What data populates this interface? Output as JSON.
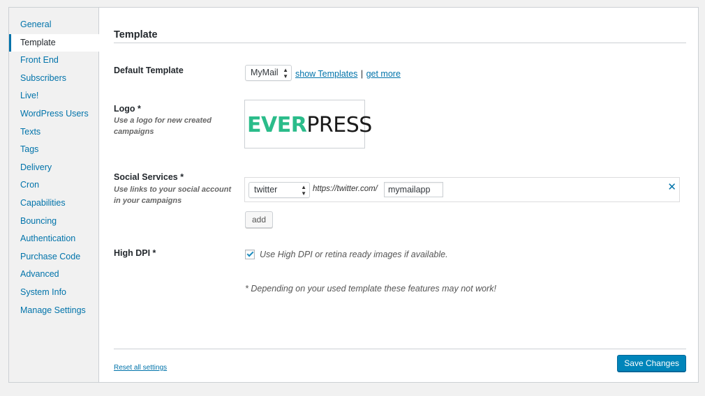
{
  "sidebar": {
    "items": [
      {
        "label": "General"
      },
      {
        "label": "Template"
      },
      {
        "label": "Front End"
      },
      {
        "label": "Subscribers"
      },
      {
        "label": "Live!"
      },
      {
        "label": "WordPress Users"
      },
      {
        "label": "Texts"
      },
      {
        "label": "Tags"
      },
      {
        "label": "Delivery"
      },
      {
        "label": "Cron"
      },
      {
        "label": "Capabilities"
      },
      {
        "label": "Bouncing"
      },
      {
        "label": "Authentication"
      },
      {
        "label": "Purchase Code"
      },
      {
        "label": "Advanced"
      },
      {
        "label": "System Info"
      },
      {
        "label": "Manage Settings"
      }
    ],
    "active": "Template"
  },
  "main": {
    "title": "Template",
    "default_template": {
      "label": "Default Template",
      "selected": "MyMail",
      "show_link": "show Templates",
      "separator": "|",
      "more_link": "get more"
    },
    "logo": {
      "label": "Logo *",
      "description": "Use a logo for new created campaigns",
      "brand_part1": "EVER",
      "brand_part2": "PRESS"
    },
    "social": {
      "label": "Social Services *",
      "description": "Use links to your social account in your campaigns",
      "service": "twitter",
      "url_prefix": "https://twitter.com/",
      "username": "mymailapp",
      "add_label": "add"
    },
    "high_dpi": {
      "label": "High DPI *",
      "checked": true,
      "text": "Use High DPI or retina ready images if available."
    },
    "note": "* Depending on your used template these features may not work!"
  },
  "footer": {
    "reset_label": "Reset all settings",
    "save_label": "Save Changes"
  },
  "colors": {
    "accent": "#0073aa",
    "primary_button": "#0085ba",
    "logo_green": "#2bbc8a"
  }
}
